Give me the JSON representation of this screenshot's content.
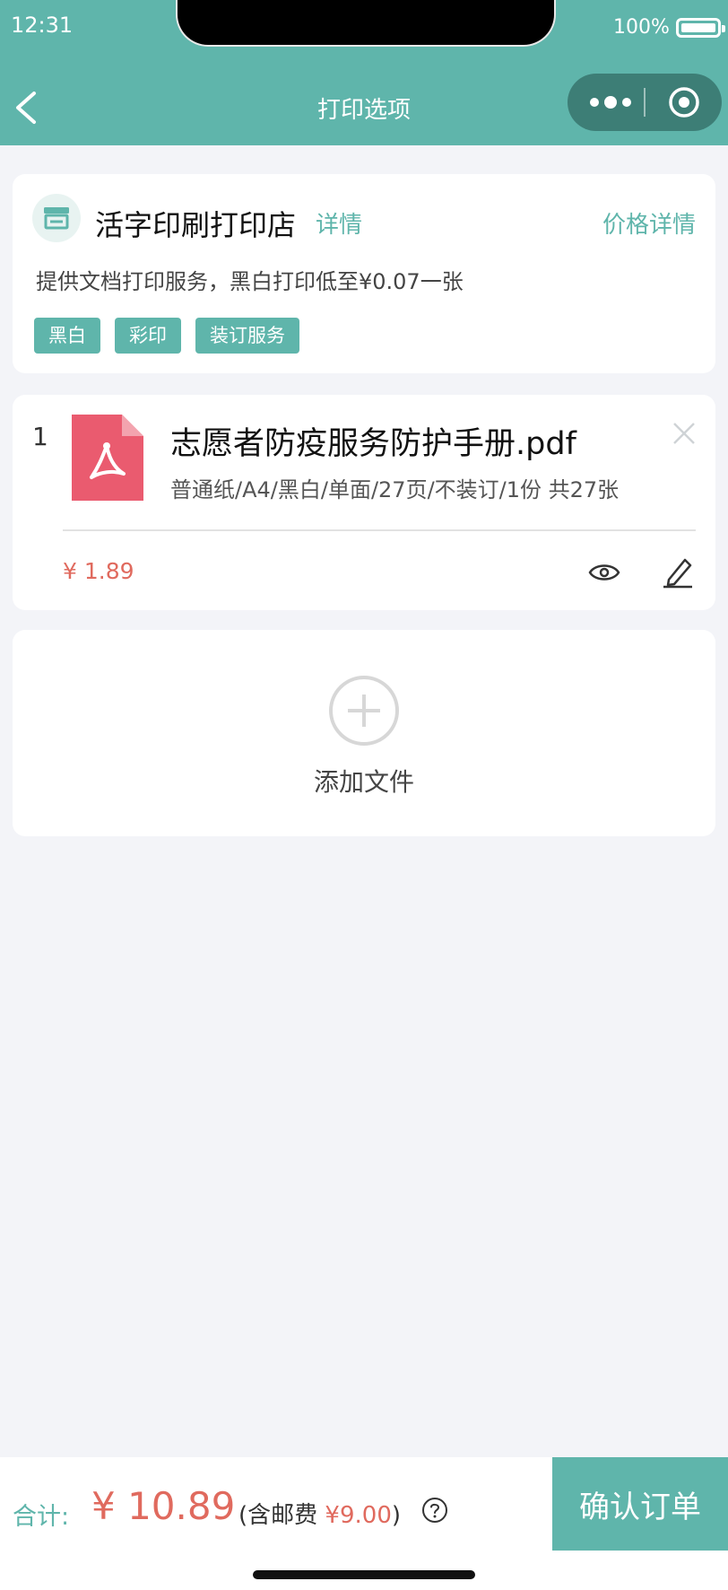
{
  "status_bar": {
    "time": "12:31",
    "battery": "100%"
  },
  "nav": {
    "title": "打印选项"
  },
  "shop": {
    "name": "活字印刷打印店",
    "detail_link": "详情",
    "price_detail_link": "价格详情",
    "description": "提供文档打印服务，黑白打印低至¥0.07一张",
    "tags": [
      "黑白",
      "彩印",
      "装订服务"
    ]
  },
  "files": [
    {
      "index": "1",
      "name": "志愿者防疫服务防护手册.pdf",
      "spec": "普通纸/A4/黑白/单面/27页/不装订/1份 共27张",
      "price": "¥ 1.89"
    }
  ],
  "add_file": {
    "label": "添加文件"
  },
  "footer": {
    "total_label": "合计:",
    "total_amount": "¥ 10.89",
    "note_prefix": "(含邮费 ",
    "shipping": "¥9.00",
    "note_suffix": ")",
    "confirm_label": "确认订单"
  },
  "colors": {
    "accent": "#5fb5ab",
    "price": "#e06a5e",
    "pdf": "#ea5b6f"
  },
  "icons": [
    "back-arrow-icon",
    "more-icon",
    "target-icon",
    "store-icon",
    "pdf-file-icon",
    "close-icon",
    "eye-icon",
    "edit-icon",
    "add-circle-icon",
    "help-icon"
  ]
}
